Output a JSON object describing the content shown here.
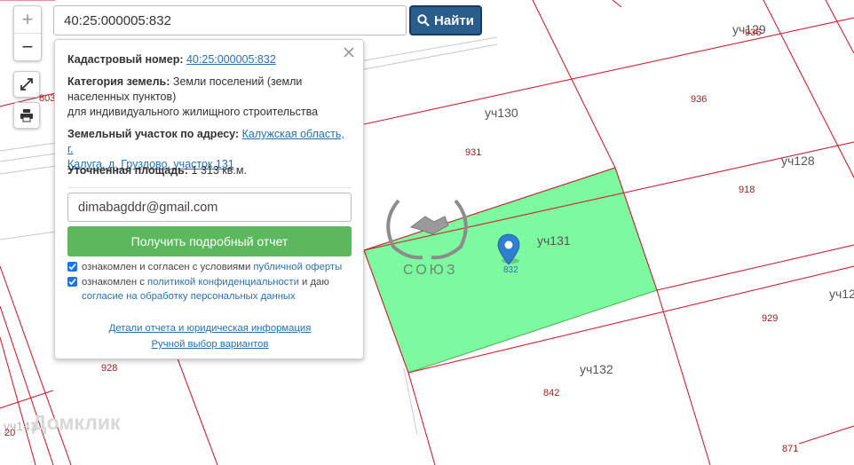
{
  "search": {
    "value": "40:25:000005:832",
    "button_label": "Найти"
  },
  "zoom": {
    "in_label": "+",
    "out_label": "−"
  },
  "popup": {
    "cadastral_label": "Кадастровый номер:",
    "cadastral_value": "40:25:000005:832",
    "category_label": "Категория земель:",
    "category_text1": "Земли поселений (земли",
    "category_text2": "населенных пунктов)",
    "category_text3": "для индивидуального жилищного строительства",
    "address_label": "Земельный участок по адресу:",
    "address_link1": "Калужская область, г.",
    "address_link2": "Калуга, д. Груздово, участок 131",
    "area_label": "Уточненная площадь:",
    "area_value": "1 313 кв.м.",
    "email_value": "dimabagddr@gmail.com",
    "report_button": "Получить подробный отчет",
    "consent1_prefix": "ознакомлен и согласен с условиями",
    "consent1_link": "публичной оферты",
    "consent2_prefix": "ознакомлен с",
    "consent2_link": "политикой конфиденциальности",
    "consent2_mid": "и даю",
    "consent2_link2": "согласие на обработку персональных данных",
    "details_link": "Детали отчета и юридическая информация",
    "manual_link": "Ручной выбор вариантов"
  },
  "map": {
    "plots": [
      "уч130",
      "уч131",
      "уч132",
      "уч128",
      "уч129",
      "уч12",
      "уч141"
    ],
    "numbers": [
      "936",
      "936",
      "931",
      "918",
      "929",
      "842",
      "871",
      "928",
      "803",
      "832",
      "20"
    ],
    "watermark": "Домклик",
    "logo_text": "СОЮЗ",
    "highlight_color": "#7dfa9f",
    "line_color": "#cc2233",
    "pin_color": "#2f7fd0"
  }
}
